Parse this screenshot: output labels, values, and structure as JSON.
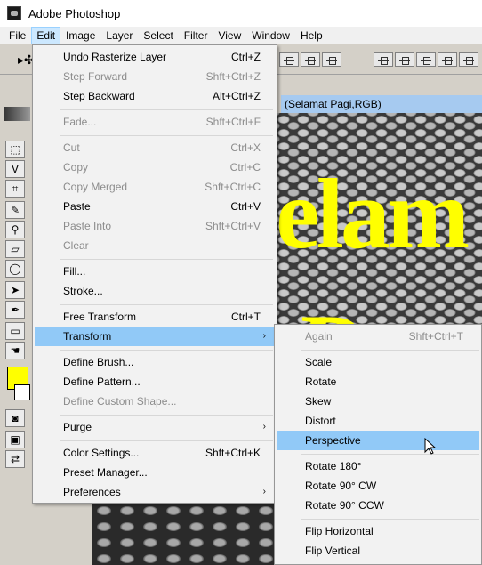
{
  "window": {
    "title": "Adobe Photoshop"
  },
  "menubar": [
    "File",
    "Edit",
    "Image",
    "Layer",
    "Select",
    "Filter",
    "View",
    "Window",
    "Help"
  ],
  "document": {
    "title_fragment": "(Selamat Pagi,RGB)",
    "canvas_text_1": "elam",
    "canvas_text_2": "P"
  },
  "edit_menu": {
    "undo": {
      "label": "Undo Rasterize Layer",
      "shortcut": "Ctrl+Z"
    },
    "step_forward": {
      "label": "Step Forward",
      "shortcut": "Shft+Ctrl+Z"
    },
    "step_backward": {
      "label": "Step Backward",
      "shortcut": "Alt+Ctrl+Z"
    },
    "fade": {
      "label": "Fade...",
      "shortcut": "Shft+Ctrl+F"
    },
    "cut": {
      "label": "Cut",
      "shortcut": "Ctrl+X"
    },
    "copy": {
      "label": "Copy",
      "shortcut": "Ctrl+C"
    },
    "copy_merged": {
      "label": "Copy Merged",
      "shortcut": "Shft+Ctrl+C"
    },
    "paste": {
      "label": "Paste",
      "shortcut": "Ctrl+V"
    },
    "paste_into": {
      "label": "Paste Into",
      "shortcut": "Shft+Ctrl+V"
    },
    "clear": {
      "label": "Clear"
    },
    "fill": {
      "label": "Fill..."
    },
    "stroke": {
      "label": "Stroke..."
    },
    "free_transform": {
      "label": "Free Transform",
      "shortcut": "Ctrl+T"
    },
    "transform": {
      "label": "Transform"
    },
    "define_brush": {
      "label": "Define Brush..."
    },
    "define_pattern": {
      "label": "Define Pattern..."
    },
    "define_custom_shape": {
      "label": "Define Custom Shape..."
    },
    "purge": {
      "label": "Purge"
    },
    "color_settings": {
      "label": "Color Settings...",
      "shortcut": "Shft+Ctrl+K"
    },
    "preset_manager": {
      "label": "Preset Manager..."
    },
    "preferences": {
      "label": "Preferences"
    }
  },
  "transform_menu": {
    "again": {
      "label": "Again",
      "shortcut": "Shft+Ctrl+T"
    },
    "scale": "Scale",
    "rotate": "Rotate",
    "skew": "Skew",
    "distort": "Distort",
    "perspective": "Perspective",
    "rotate_180": "Rotate 180°",
    "rotate_90_cw": "Rotate 90° CW",
    "rotate_90_ccw": "Rotate 90° CCW",
    "flip_horizontal": "Flip Horizontal",
    "flip_vertical": "Flip Vertical"
  },
  "colors": {
    "foreground": "#ffff00",
    "background": "#ffffff",
    "highlight": "#91c9f7"
  }
}
